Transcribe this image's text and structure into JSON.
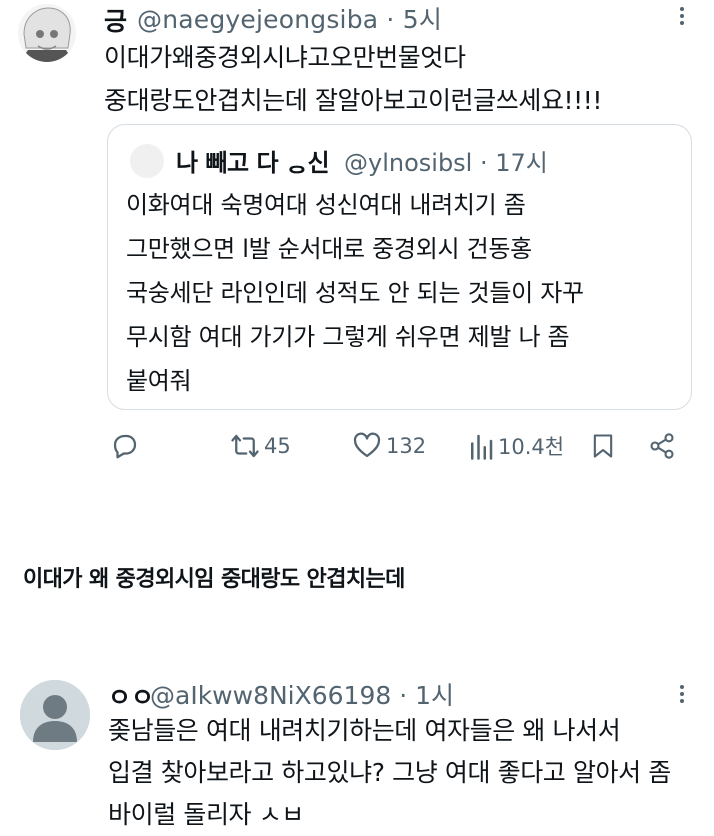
{
  "tweet1": {
    "name": "긍",
    "handle_line": "@naegyejeongsiba · 5시",
    "lines": [
      "이대가왜중경외시냐고오만번물엇다",
      "중대랑도안겹치는데 잘알아보고이런글쓰세요!!!!"
    ]
  },
  "quote": {
    "name": "나 빼고 다 ᆼ신",
    "handle_line": "@ylnosibsl · 17시",
    "lines": [
      "이화여대 숙명여대 성신여대 내려치기 좀",
      "그만했으면 l발 순서대로 중경외시 건동홍",
      "국숭세단 라인인데 성적도 안 되는 것들이 자꾸",
      "무시함 여대 가기가 그렇게 쉬우면 제발 나 좀",
      "붙여줘"
    ]
  },
  "actions": {
    "retweets": "45",
    "likes": "132",
    "views": "10.4천"
  },
  "caption": "이대가 왜 중경외시임 중대랑도 안겹치는데",
  "tweet2": {
    "name": "ㅇㅇ",
    "handle_line": "@aIkww8NiX66198 · 1시",
    "lines": [
      "좆남들은 여대 내려치기하는데 여자들은 왜 나서서",
      "입결 찾아보라고 하고있냐? 그냥 여대 좋다고 알아서 좀",
      "바이럴 돌리자 ㅅㅂ"
    ]
  },
  "colors": {
    "text": "#0f1419",
    "secondary": "#536471",
    "border": "#d6dde3",
    "avatar_placeholder": "#cfd9de"
  }
}
